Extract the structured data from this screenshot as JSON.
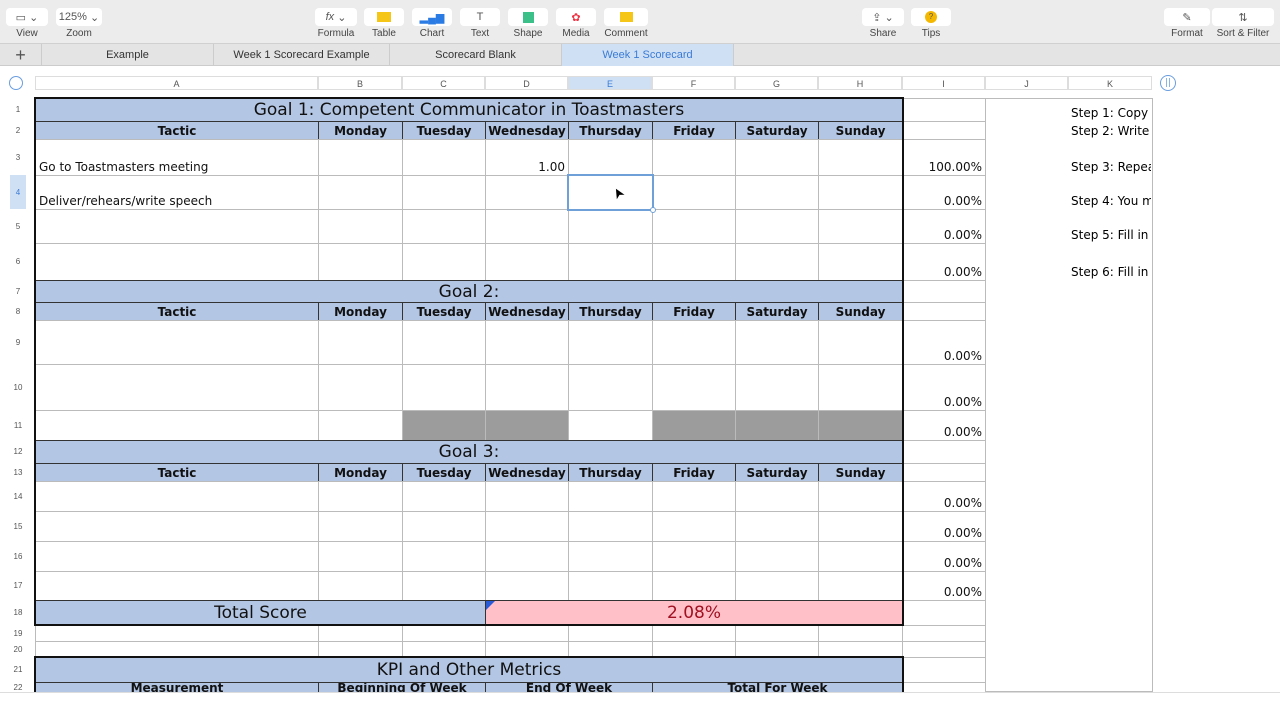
{
  "toolbar": {
    "view": "View",
    "zoom_value": "125%",
    "zoom": "Zoom",
    "formula": "Formula",
    "table": "Table",
    "chart": "Chart",
    "text": "Text",
    "shape": "Shape",
    "media": "Media",
    "comment": "Comment",
    "share": "Share",
    "tips": "Tips",
    "format": "Format",
    "sort_filter": "Sort & Filter"
  },
  "sheets": [
    {
      "label": "Example"
    },
    {
      "label": "Week 1 Scorecard Example"
    },
    {
      "label": "Scorecard Blank"
    },
    {
      "label": "Week 1 Scorecard",
      "active": true
    }
  ],
  "columns": [
    "A",
    "B",
    "C",
    "D",
    "E",
    "F",
    "G",
    "H",
    "I",
    "J",
    "K"
  ],
  "selected_cell": "E4",
  "days": [
    "Tactic",
    "Monday",
    "Tuesday",
    "Wednesday",
    "Thursday",
    "Friday",
    "Saturday",
    "Sunday"
  ],
  "goal1": {
    "title": "Goal 1: Competent Communicator in Toastmasters",
    "tactics": [
      "Go to Toastmasters meeting",
      "Deliver/rehears/write speech",
      "",
      ""
    ],
    "wednesday_row3": "1.00",
    "scores": [
      "100.00%",
      "0.00%",
      "0.00%",
      "0.00%"
    ]
  },
  "goal2": {
    "title": "Goal 2:",
    "scores": [
      "0.00%",
      "0.00%",
      "0.00%"
    ]
  },
  "goal3": {
    "title": "Goal 3:",
    "scores": [
      "0.00%",
      "0.00%",
      "0.00%",
      "0.00%"
    ]
  },
  "total": {
    "label": "Total Score",
    "value": "2.08%"
  },
  "kpi": {
    "title": "KPI and Other Metrics",
    "headers": [
      "Measurement",
      "Beginning Of Week",
      "End Of Week",
      "Total For Week"
    ]
  },
  "steps": [
    "Step 1: Copy",
    "Step 2: Write",
    "Step 3: Repea",
    "Step 4: You m",
    "Step 5: Fill in",
    "Step 6: Fill in"
  ],
  "colors": {
    "header_blue": "#b3c6e4",
    "total_pink": "#ffc0c8",
    "total_text": "#a01020",
    "selection": "#3a7bd5"
  }
}
